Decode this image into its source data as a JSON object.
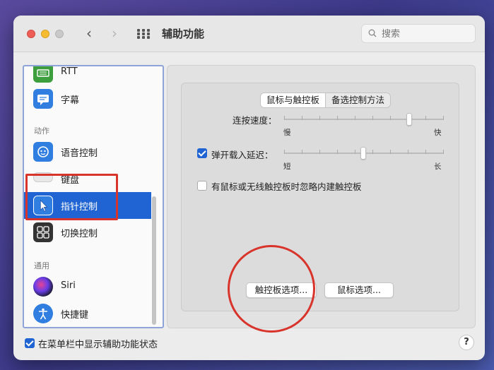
{
  "window": {
    "title": "辅助功能",
    "nav_back": "‹",
    "nav_forward": "›"
  },
  "search": {
    "placeholder": "搜索"
  },
  "sidebar": {
    "items": [
      {
        "label": "RTT",
        "icon": "rtt-icon"
      },
      {
        "label": "字幕",
        "icon": "captions-icon"
      },
      {
        "label": "语音控制",
        "icon": "voice-control-icon"
      },
      {
        "label": "键盘",
        "icon": "keyboard-icon"
      },
      {
        "label": "指针控制",
        "icon": "pointer-control-icon",
        "selected": true
      },
      {
        "label": "切换控制",
        "icon": "switch-control-icon"
      },
      {
        "label": "Siri",
        "icon": "siri-icon"
      },
      {
        "label": "快捷键",
        "icon": "shortcut-icon"
      }
    ],
    "sections": {
      "action": "动作",
      "general": "通用"
    }
  },
  "tabs": [
    {
      "label": "鼠标与触控板",
      "active": true
    },
    {
      "label": "备选控制方法",
      "active": false
    }
  ],
  "settings": {
    "double_click_speed": {
      "label": "连按速度：",
      "min_label": "慢",
      "max_label": "快",
      "value_fraction": 0.85
    },
    "spring_loading": {
      "label": "弹开载入延迟：",
      "checked": true,
      "min_label": "短",
      "max_label": "长",
      "value_fraction": 0.5
    },
    "ignore_trackpad": {
      "label": "有鼠标或无线触控板时忽略内建触控板",
      "checked": false
    }
  },
  "buttons": {
    "trackpad_options": "触控板选项...",
    "mouse_options": "鼠标选项..."
  },
  "footer": {
    "show_in_menubar": {
      "label": "在菜单栏中显示辅助功能状态",
      "checked": true
    },
    "help": "?"
  },
  "colors": {
    "accent": "#1f64d2",
    "annotation": "#d9342b"
  }
}
